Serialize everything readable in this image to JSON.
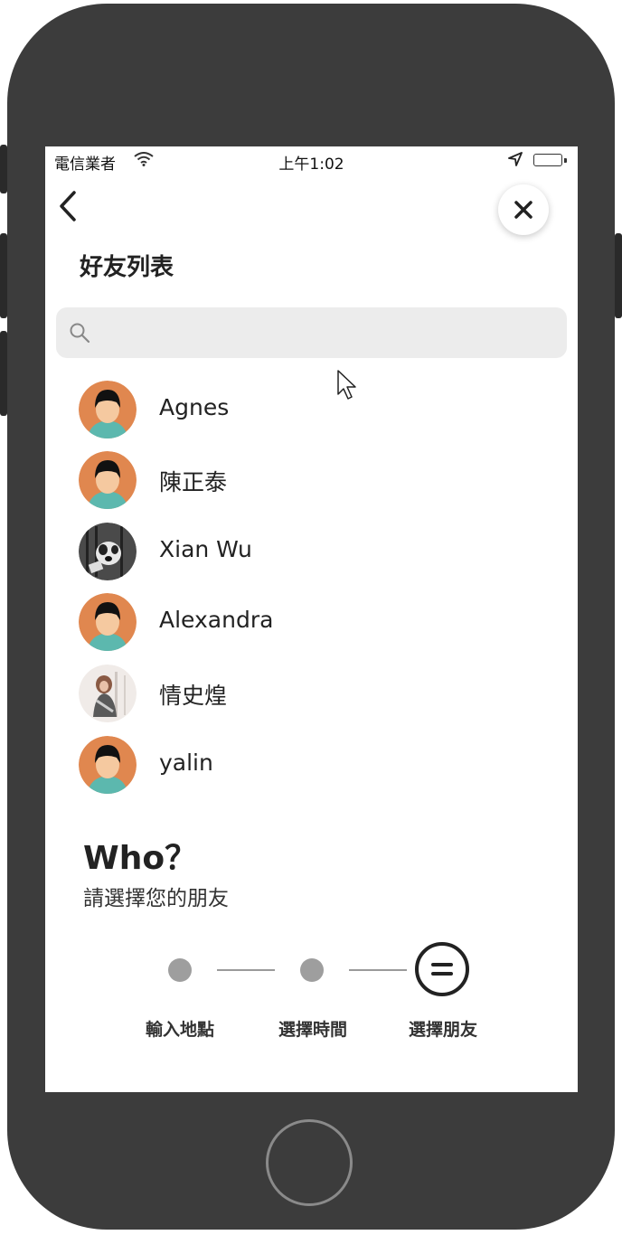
{
  "status_bar": {
    "carrier": "電信業者",
    "time": "上午1:02"
  },
  "header": {
    "title": "好友列表"
  },
  "search": {
    "placeholder": ""
  },
  "friends": [
    {
      "name": "Agnes",
      "avatar": "default-avatar"
    },
    {
      "name": "陳正泰",
      "avatar": "default-avatar"
    },
    {
      "name": "Xian Wu",
      "avatar": "photo-avatar"
    },
    {
      "name": "Alexandra",
      "avatar": "default-avatar"
    },
    {
      "name": "情史煌",
      "avatar": "photo-avatar"
    },
    {
      "name": "yalin",
      "avatar": "default-avatar"
    }
  ],
  "prompt": {
    "heading": "Who？",
    "subtitle": "請選擇您的朋友"
  },
  "steps": [
    {
      "label": "輸入地點",
      "state": "done"
    },
    {
      "label": "選擇時間",
      "state": "done"
    },
    {
      "label": "選擇朋友",
      "state": "current"
    }
  ],
  "colors": {
    "avatar_bg": "#e0874f",
    "avatar_shirt": "#5cb8ae",
    "avatar_skin": "#f5c9a0",
    "search_bg": "#ececec",
    "phone_frame": "#3c3c3c"
  }
}
